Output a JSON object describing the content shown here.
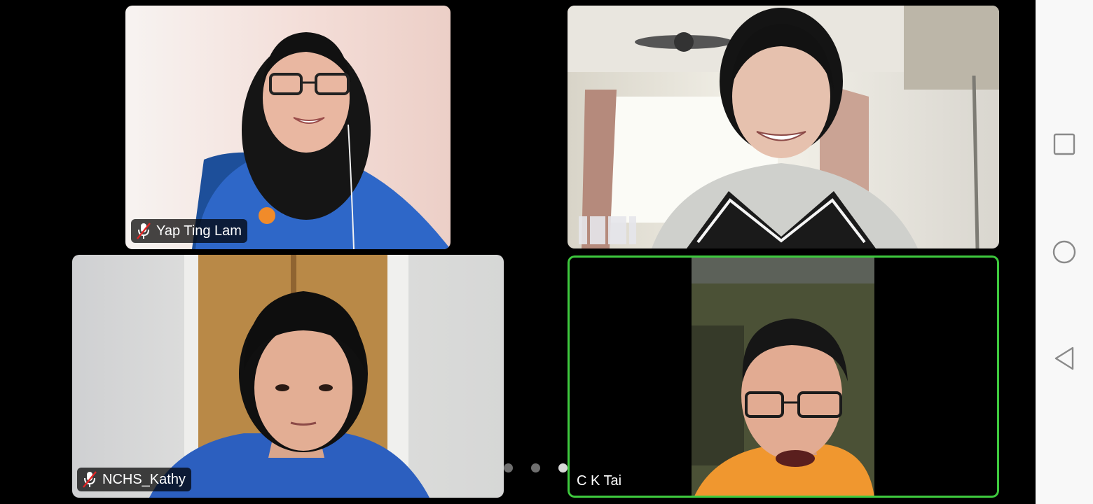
{
  "meeting": {
    "participants": [
      {
        "name": "Yap Ting Lam",
        "muted": true,
        "active_speaker": false
      },
      {
        "name": "",
        "muted": false,
        "active_speaker": false
      },
      {
        "name": "NCHS_Kathy",
        "muted": true,
        "active_speaker": false
      },
      {
        "name": "C K Tai",
        "muted": false,
        "active_speaker": true
      }
    ],
    "pagination": {
      "page_count": 3,
      "current_page": 3
    }
  },
  "system_nav": {
    "buttons": [
      "recents-button",
      "home-button",
      "back-button"
    ]
  },
  "colors": {
    "background": "#000000",
    "active_speaker_outline": "#3ec93e",
    "name_tag_background": "rgba(0,0,0,0.72)",
    "navbar_background": "#f8f8f8",
    "navbar_icon": "#8a8a8a"
  },
  "icons": {
    "muted_mic": "microphone-muted-icon",
    "recents": "square-icon",
    "home": "circle-icon",
    "back": "triangle-back-icon"
  }
}
